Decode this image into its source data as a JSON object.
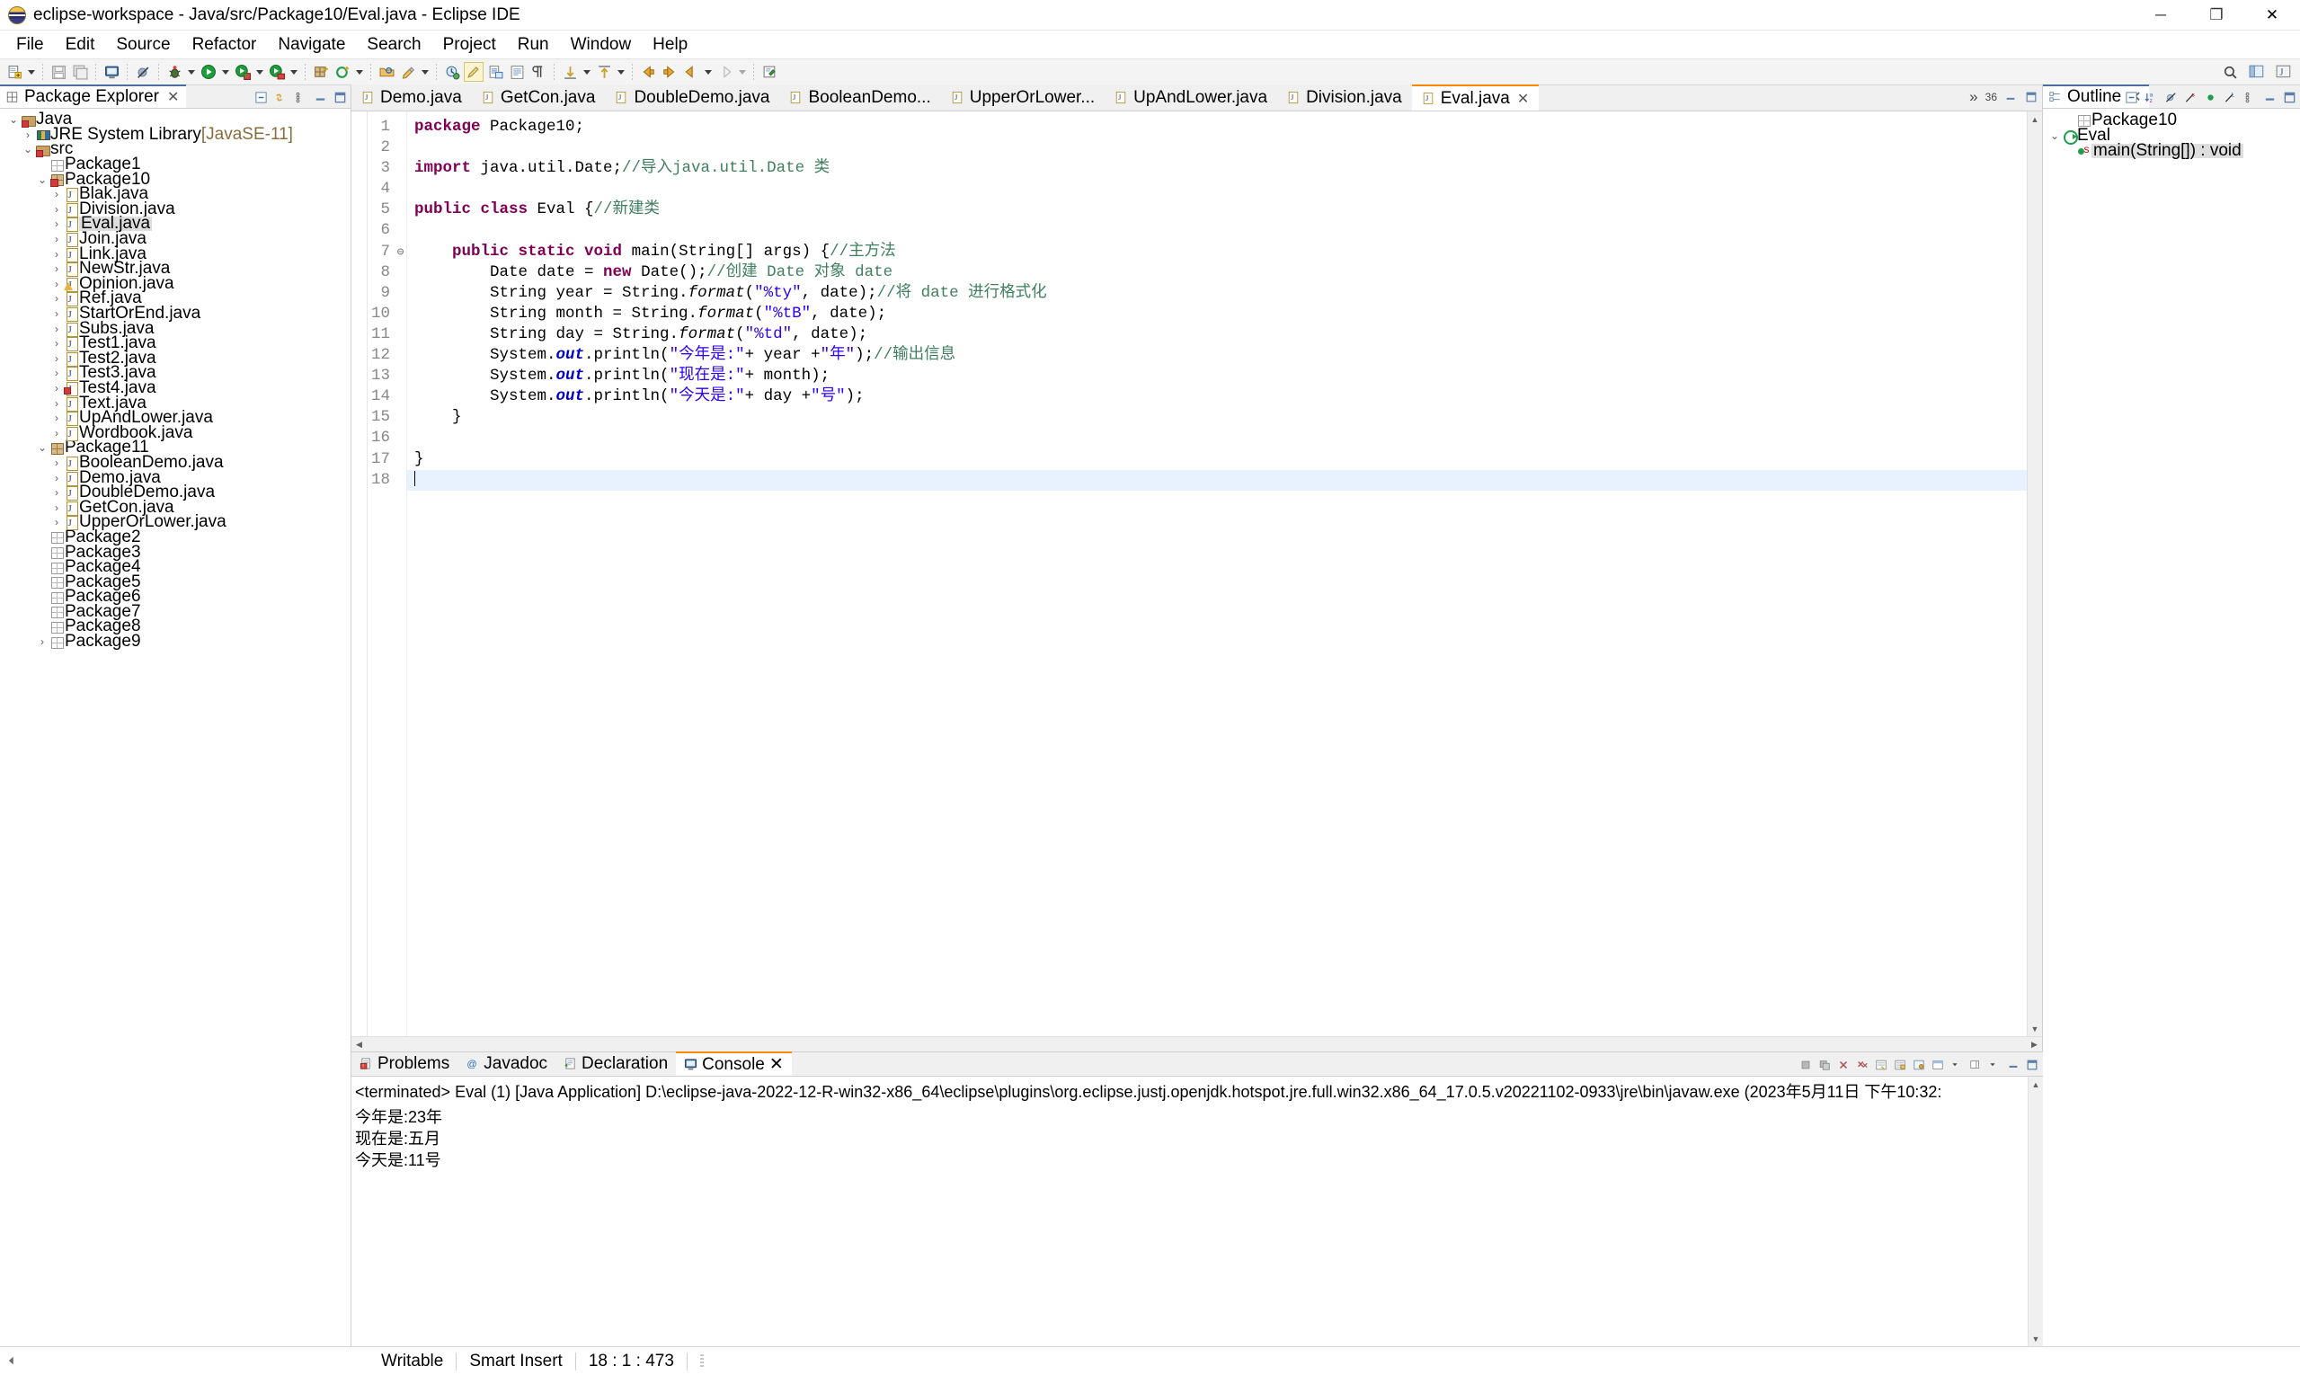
{
  "window": {
    "title": "eclipse-workspace - Java/src/Package10/Eval.java - Eclipse IDE",
    "minimize": "─",
    "maximize": "❐",
    "close": "✕"
  },
  "menubar": [
    "File",
    "Edit",
    "Source",
    "Refactor",
    "Navigate",
    "Search",
    "Project",
    "Run",
    "Window",
    "Help"
  ],
  "package_explorer": {
    "tab_label": "Package Explorer",
    "tab_close": "✕",
    "tree": [
      {
        "depth": 0,
        "twist": "⌄",
        "icon": "java-project-icon",
        "label": "Java",
        "suffix": "",
        "selected": false
      },
      {
        "depth": 1,
        "twist": "›",
        "icon": "jre-library-icon",
        "label": "JRE System Library",
        "suffix": " [JavaSE-11]",
        "selected": false
      },
      {
        "depth": 1,
        "twist": "⌄",
        "icon": "source-folder-icon",
        "label": "src",
        "suffix": "",
        "selected": false
      },
      {
        "depth": 2,
        "twist": "",
        "icon": "package-icon",
        "label": "Package1",
        "suffix": "",
        "selected": false
      },
      {
        "depth": 2,
        "twist": "⌄",
        "icon": "package-error-icon",
        "label": "Package10",
        "suffix": "",
        "selected": false
      },
      {
        "depth": 3,
        "twist": "›",
        "icon": "java-file-icon",
        "label": "Blak.java",
        "suffix": "",
        "selected": false
      },
      {
        "depth": 3,
        "twist": "›",
        "icon": "java-file-icon",
        "label": "Division.java",
        "suffix": "",
        "selected": false
      },
      {
        "depth": 3,
        "twist": "›",
        "icon": "java-file-icon",
        "label": "Eval.java",
        "suffix": "",
        "selected": true
      },
      {
        "depth": 3,
        "twist": "›",
        "icon": "java-file-icon",
        "label": "Join.java",
        "suffix": "",
        "selected": false
      },
      {
        "depth": 3,
        "twist": "›",
        "icon": "java-file-icon",
        "label": "Link.java",
        "suffix": "",
        "selected": false
      },
      {
        "depth": 3,
        "twist": "›",
        "icon": "java-file-icon",
        "label": "NewStr.java",
        "suffix": "",
        "selected": false
      },
      {
        "depth": 3,
        "twist": "›",
        "icon": "java-file-warning-icon",
        "label": "Opinion.java",
        "suffix": "",
        "selected": false
      },
      {
        "depth": 3,
        "twist": "›",
        "icon": "java-file-icon",
        "label": "Ref.java",
        "suffix": "",
        "selected": false
      },
      {
        "depth": 3,
        "twist": "›",
        "icon": "java-file-icon",
        "label": "StartOrEnd.java",
        "suffix": "",
        "selected": false
      },
      {
        "depth": 3,
        "twist": "›",
        "icon": "java-file-icon",
        "label": "Subs.java",
        "suffix": "",
        "selected": false
      },
      {
        "depth": 3,
        "twist": "›",
        "icon": "java-file-icon",
        "label": "Test1.java",
        "suffix": "",
        "selected": false
      },
      {
        "depth": 3,
        "twist": "›",
        "icon": "java-file-icon",
        "label": "Test2.java",
        "suffix": "",
        "selected": false
      },
      {
        "depth": 3,
        "twist": "›",
        "icon": "java-file-icon",
        "label": "Test3.java",
        "suffix": "",
        "selected": false
      },
      {
        "depth": 3,
        "twist": "›",
        "icon": "java-file-error-icon",
        "label": "Test4.java",
        "suffix": "",
        "selected": false
      },
      {
        "depth": 3,
        "twist": "›",
        "icon": "java-file-icon",
        "label": "Text.java",
        "suffix": "",
        "selected": false
      },
      {
        "depth": 3,
        "twist": "›",
        "icon": "java-file-icon",
        "label": "UpAndLower.java",
        "suffix": "",
        "selected": false
      },
      {
        "depth": 3,
        "twist": "›",
        "icon": "java-file-icon",
        "label": "Wordbook.java",
        "suffix": "",
        "selected": false
      },
      {
        "depth": 2,
        "twist": "⌄",
        "icon": "package-filled-icon",
        "label": "Package11",
        "suffix": "",
        "selected": false
      },
      {
        "depth": 3,
        "twist": "›",
        "icon": "java-file-icon",
        "label": "BooleanDemo.java",
        "suffix": "",
        "selected": false
      },
      {
        "depth": 3,
        "twist": "›",
        "icon": "java-file-icon",
        "label": "Demo.java",
        "suffix": "",
        "selected": false
      },
      {
        "depth": 3,
        "twist": "›",
        "icon": "java-file-icon",
        "label": "DoubleDemo.java",
        "suffix": "",
        "selected": false
      },
      {
        "depth": 3,
        "twist": "›",
        "icon": "java-file-icon",
        "label": "GetCon.java",
        "suffix": "",
        "selected": false
      },
      {
        "depth": 3,
        "twist": "›",
        "icon": "java-file-icon",
        "label": "UpperOrLower.java",
        "suffix": "",
        "selected": false
      },
      {
        "depth": 2,
        "twist": "",
        "icon": "package-icon",
        "label": "Package2",
        "suffix": "",
        "selected": false
      },
      {
        "depth": 2,
        "twist": "",
        "icon": "package-icon",
        "label": "Package3",
        "suffix": "",
        "selected": false
      },
      {
        "depth": 2,
        "twist": "",
        "icon": "package-icon",
        "label": "Package4",
        "suffix": "",
        "selected": false
      },
      {
        "depth": 2,
        "twist": "",
        "icon": "package-icon",
        "label": "Package5",
        "suffix": "",
        "selected": false
      },
      {
        "depth": 2,
        "twist": "",
        "icon": "package-icon",
        "label": "Package6",
        "suffix": "",
        "selected": false
      },
      {
        "depth": 2,
        "twist": "",
        "icon": "package-icon",
        "label": "Package7",
        "suffix": "",
        "selected": false
      },
      {
        "depth": 2,
        "twist": "",
        "icon": "package-icon",
        "label": "Package8",
        "suffix": "",
        "selected": false
      },
      {
        "depth": 2,
        "twist": "›",
        "icon": "package-icon",
        "label": "Package9",
        "suffix": "",
        "selected": false
      }
    ]
  },
  "editor": {
    "tabs": [
      {
        "label": "Demo.java",
        "active": false
      },
      {
        "label": "GetCon.java",
        "active": false
      },
      {
        "label": "DoubleDemo.java",
        "active": false
      },
      {
        "label": "BooleanDemo...",
        "active": false
      },
      {
        "label": "UpperOrLower...",
        "active": false
      },
      {
        "label": "UpAndLower.java",
        "active": false
      },
      {
        "label": "Division.java",
        "active": false
      },
      {
        "label": "Eval.java",
        "active": true
      }
    ],
    "tab_close": "✕",
    "tab_overflow": "»",
    "tab_overflow_count": "36",
    "line_numbers": [
      "1",
      "2",
      "3",
      "4",
      "5",
      "6",
      "7",
      "8",
      "9",
      "10",
      "11",
      "12",
      "13",
      "14",
      "15",
      "16",
      "17",
      "18"
    ],
    "fold_marker_line": 7,
    "fold_glyph": "⊖",
    "current_line": 18,
    "code_lines": [
      {
        "n": 1,
        "segments": [
          {
            "t": "package ",
            "c": "kw"
          },
          {
            "t": "Package10;",
            "c": ""
          }
        ]
      },
      {
        "n": 2,
        "segments": []
      },
      {
        "n": 3,
        "segments": [
          {
            "t": "import ",
            "c": "kw"
          },
          {
            "t": "java.util.Date;",
            "c": ""
          },
          {
            "t": "//导入java.util.Date 类",
            "c": "cm"
          }
        ]
      },
      {
        "n": 4,
        "segments": []
      },
      {
        "n": 5,
        "segments": [
          {
            "t": "public class ",
            "c": "kw"
          },
          {
            "t": "Eval {",
            "c": ""
          },
          {
            "t": "//新建类",
            "c": "cm"
          }
        ]
      },
      {
        "n": 6,
        "segments": []
      },
      {
        "n": 7,
        "segments": [
          {
            "t": "    ",
            "c": ""
          },
          {
            "t": "public static void ",
            "c": "kw"
          },
          {
            "t": "main(String[] args) {",
            "c": ""
          },
          {
            "t": "//主方法",
            "c": "cm"
          }
        ]
      },
      {
        "n": 8,
        "segments": [
          {
            "t": "        Date date = ",
            "c": ""
          },
          {
            "t": "new ",
            "c": "kw"
          },
          {
            "t": "Date();",
            "c": ""
          },
          {
            "t": "//创建 Date 对象 date",
            "c": "cm"
          }
        ]
      },
      {
        "n": 9,
        "segments": [
          {
            "t": "        String year = String.",
            "c": ""
          },
          {
            "t": "format",
            "c": "it"
          },
          {
            "t": "(",
            "c": ""
          },
          {
            "t": "\"%ty\"",
            "c": "st"
          },
          {
            "t": ", date);",
            "c": ""
          },
          {
            "t": "//将 date 进行格式化",
            "c": "cm"
          }
        ]
      },
      {
        "n": 10,
        "segments": [
          {
            "t": "        String month = String.",
            "c": ""
          },
          {
            "t": "format",
            "c": "it"
          },
          {
            "t": "(",
            "c": ""
          },
          {
            "t": "\"%tB\"",
            "c": "st"
          },
          {
            "t": ", date);",
            "c": ""
          }
        ]
      },
      {
        "n": 11,
        "segments": [
          {
            "t": "        String day = String.",
            "c": ""
          },
          {
            "t": "format",
            "c": "it"
          },
          {
            "t": "(",
            "c": ""
          },
          {
            "t": "\"%td\"",
            "c": "st"
          },
          {
            "t": ", date);",
            "c": ""
          }
        ]
      },
      {
        "n": 12,
        "segments": [
          {
            "t": "        System.",
            "c": ""
          },
          {
            "t": "out",
            "c": "sf"
          },
          {
            "t": ".println(",
            "c": ""
          },
          {
            "t": "\"今年是:\"",
            "c": "st"
          },
          {
            "t": "+ year +",
            "c": ""
          },
          {
            "t": "\"年\"",
            "c": "st"
          },
          {
            "t": ");",
            "c": ""
          },
          {
            "t": "//输出信息",
            "c": "cm"
          }
        ]
      },
      {
        "n": 13,
        "segments": [
          {
            "t": "        System.",
            "c": ""
          },
          {
            "t": "out",
            "c": "sf"
          },
          {
            "t": ".println(",
            "c": ""
          },
          {
            "t": "\"现在是:\"",
            "c": "st"
          },
          {
            "t": "+ month);",
            "c": ""
          }
        ]
      },
      {
        "n": 14,
        "segments": [
          {
            "t": "        System.",
            "c": ""
          },
          {
            "t": "out",
            "c": "sf"
          },
          {
            "t": ".println(",
            "c": ""
          },
          {
            "t": "\"今天是:\"",
            "c": "st"
          },
          {
            "t": "+ day +",
            "c": ""
          },
          {
            "t": "\"号\"",
            "c": "st"
          },
          {
            "t": ");",
            "c": ""
          }
        ]
      },
      {
        "n": 15,
        "segments": [
          {
            "t": "    }",
            "c": ""
          }
        ]
      },
      {
        "n": 16,
        "segments": []
      },
      {
        "n": 17,
        "segments": [
          {
            "t": "}",
            "c": ""
          }
        ]
      },
      {
        "n": 18,
        "segments": []
      }
    ]
  },
  "outline": {
    "tab_label": "Outline",
    "tab_close": "✕",
    "items": [
      {
        "depth": 1,
        "twist": "",
        "icon": "package-icon",
        "label": "Package10",
        "selected": false
      },
      {
        "depth": 0,
        "twist": "⌄",
        "icon": "class-icon",
        "label": "Eval",
        "selected": false
      },
      {
        "depth": 1,
        "twist": "",
        "icon": "method-static-icon",
        "label": "main(String[]) : void",
        "selected": true
      }
    ]
  },
  "console": {
    "tabs": [
      {
        "label": "Problems",
        "icon": "problems-icon",
        "active": false
      },
      {
        "label": "Javadoc",
        "icon": "javadoc-icon",
        "active": false
      },
      {
        "label": "Declaration",
        "icon": "declaration-icon",
        "active": false
      },
      {
        "label": "Console",
        "icon": "console-icon",
        "active": true
      }
    ],
    "tab_close": "✕",
    "terminated_line": "<terminated> Eval (1) [Java Application] D:\\eclipse-java-2022-12-R-win32-x86_64\\eclipse\\plugins\\org.eclipse.justj.openjdk.hotspot.jre.full.win32.x86_64_17.0.5.v20221102-0933\\jre\\bin\\javaw.exe  (2023年5月11日 下午10:32:",
    "output": [
      "今年是:23年",
      "现在是:五月",
      "今天是:11号"
    ]
  },
  "statusbar": {
    "writable": "Writable",
    "insert_mode": "Smart Insert",
    "position": "18 : 1 : 473"
  },
  "colors": {
    "keyword": "#7f0055",
    "comment": "#3f7f5f",
    "string": "#2a00ff",
    "active_tab_accent": "#ff8800",
    "view_tab_accent": "#4a6e9e",
    "selection": "#dedede"
  }
}
